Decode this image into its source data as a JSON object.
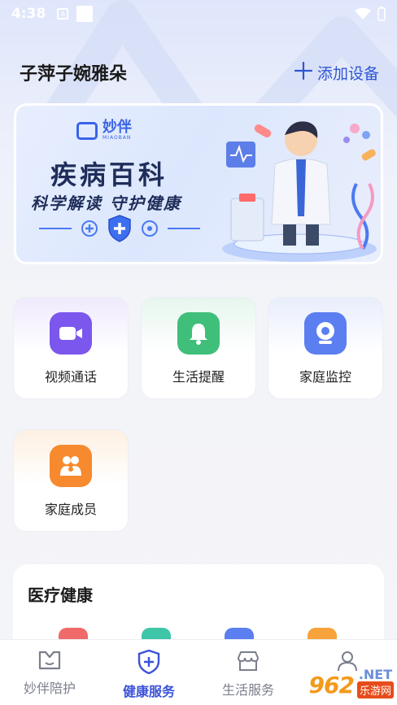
{
  "status_bar": {
    "time": "4:38",
    "icons": [
      "notification-a-icon",
      "square-icon",
      "wifi-icon",
      "battery-icon"
    ]
  },
  "header": {
    "user_name": "子萍子婉雅朵",
    "add_device_label": "添加设备"
  },
  "banner": {
    "brand_name": "妙伴",
    "brand_sub": "MIAOBAN",
    "title": "疾病百科",
    "subtitle": "科学解读  守护健康"
  },
  "services": [
    {
      "label": "视频通话",
      "icon": "video-camera-icon",
      "color": "#7b57ee"
    },
    {
      "label": "生活提醒",
      "icon": "bell-icon",
      "color": "#3fbf7a"
    },
    {
      "label": "家庭监控",
      "icon": "webcam-icon",
      "color": "#5b7ff0"
    },
    {
      "label": "家庭成员",
      "icon": "family-icon",
      "color": "#f78a2e"
    }
  ],
  "medical": {
    "title": "医疗健康"
  },
  "tabbar": {
    "tabs": [
      {
        "label": "妙伴陪护",
        "icon": "companion-icon",
        "active": false
      },
      {
        "label": "健康服务",
        "icon": "health-shield-icon",
        "active": true
      },
      {
        "label": "生活服务",
        "icon": "store-icon",
        "active": false
      },
      {
        "label": "",
        "icon": "profile-icon",
        "active": false
      }
    ]
  },
  "watermark": {
    "number": "962",
    "net": ".NET",
    "site": "乐游网"
  },
  "colors": {
    "accent": "#3a52d8",
    "add_device": "#2f55d4"
  }
}
